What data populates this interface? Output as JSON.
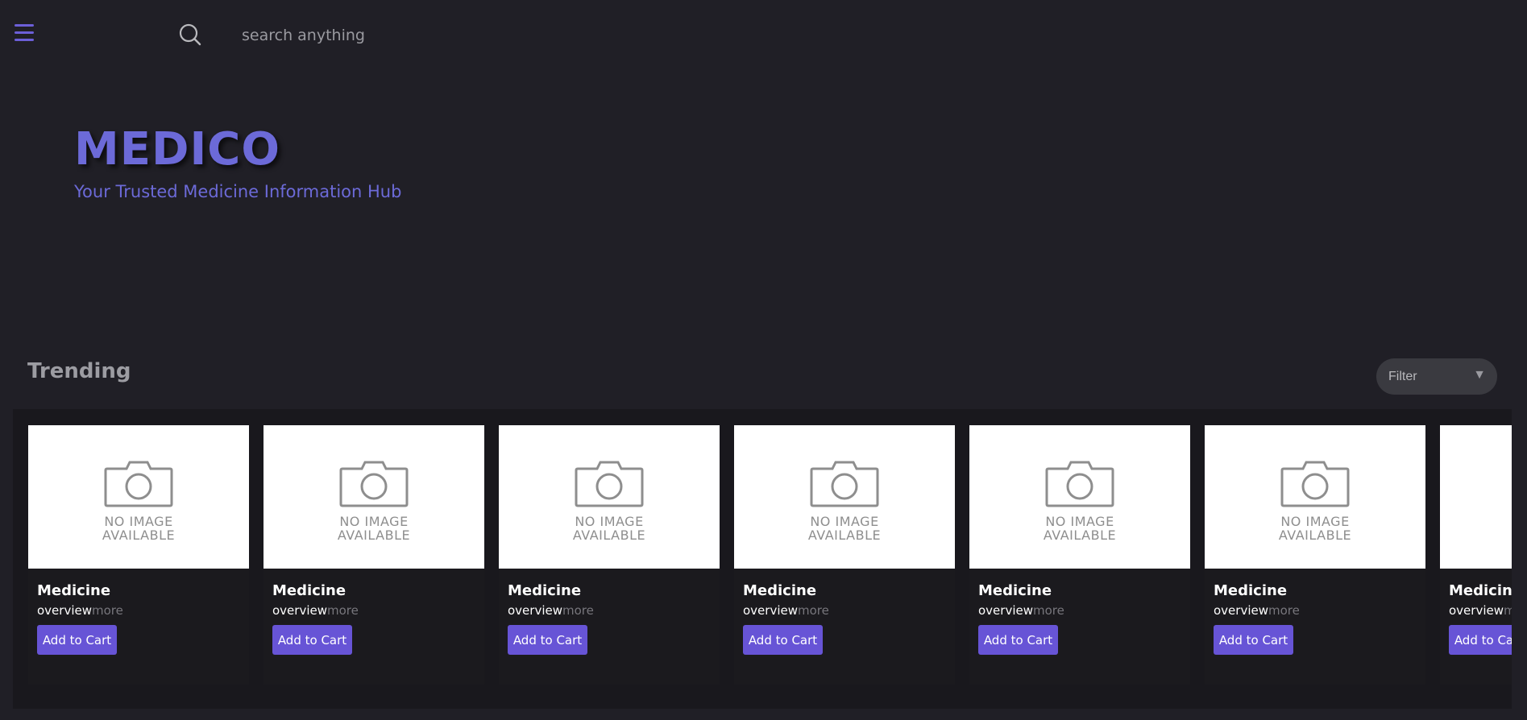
{
  "header": {
    "menu_icon": "hamburger-menu-icon",
    "search_icon": "search-icon",
    "search_placeholder": "search anything",
    "accent_color": "#6c5fd8"
  },
  "hero": {
    "brand": "MEDICO",
    "tagline": "Your Trusted Medicine Information Hub"
  },
  "trending": {
    "title": "Trending",
    "filter": {
      "label": "Filter",
      "caret": "▼"
    }
  },
  "placeholder_image": {
    "line1": "NO IMAGE",
    "line2": "AVAILABLE",
    "icon": "camera-icon"
  },
  "cards": [
    {
      "name": "Medicine",
      "overview": "overview",
      "more": "more",
      "button": "Add to Cart"
    },
    {
      "name": "Medicine",
      "overview": "overview",
      "more": "more",
      "button": "Add to Cart"
    },
    {
      "name": "Medicine",
      "overview": "overview",
      "more": "more",
      "button": "Add to Cart"
    },
    {
      "name": "Medicine",
      "overview": "overview",
      "more": "more",
      "button": "Add to Cart"
    },
    {
      "name": "Medicine",
      "overview": "overview",
      "more": "more",
      "button": "Add to Cart"
    },
    {
      "name": "Medicine",
      "overview": "overview",
      "more": "more",
      "button": "Add to Cart"
    },
    {
      "name": "Medicine",
      "overview": "overview",
      "more": "more",
      "button": "Add to Cart"
    }
  ]
}
